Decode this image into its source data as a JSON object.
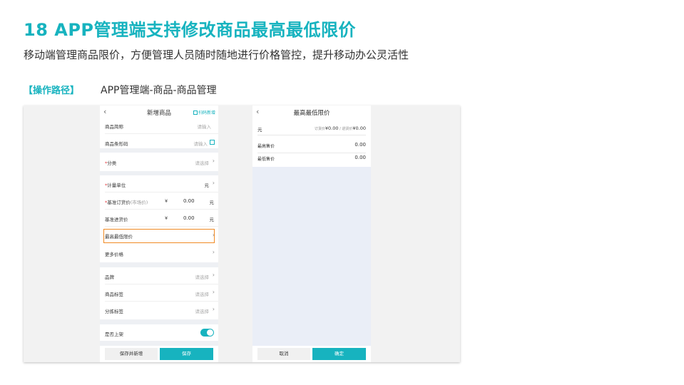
{
  "slide": {
    "title": "18  APP管理端支持修改商品最高最低限价",
    "subtitle": "移动端管理商品限价，方便管理人员随时随地进行价格管控，提升移动办公灵活性",
    "path_label": "【操作路径】",
    "path_value": "APP管理端-商品-商品管理"
  },
  "phone1": {
    "back": "‹",
    "title": "新增商品",
    "scan_label": "扫码新增",
    "rows": {
      "name": {
        "label": "商品简称",
        "placeholder": "请输入"
      },
      "barcode": {
        "label": "商品条形码",
        "placeholder": "请输入"
      },
      "category": {
        "req": "*",
        "label": "分类",
        "placeholder": "请选择"
      },
      "unit": {
        "req": "*",
        "label": "计量单位",
        "value": "元"
      },
      "order_price": {
        "req": "*",
        "label": "基准订货价",
        "hint": "(市场价)",
        "yen": "¥",
        "value": "0.00",
        "unit": "元"
      },
      "purchase_price": {
        "label": "基准进货价",
        "yen": "¥",
        "value": "0.00",
        "unit": "元"
      },
      "price_limit": {
        "label": "最高最低限价"
      },
      "more_price": {
        "label": "更多价格"
      },
      "brand": {
        "label": "品牌",
        "placeholder": "请选择"
      },
      "tag": {
        "label": "商品标签",
        "placeholder": "请选择"
      },
      "sort_tag": {
        "label": "分拣标签",
        "placeholder": "请选择"
      },
      "on_shelf": {
        "label": "是否上架",
        "checked": true
      }
    },
    "footer": {
      "save_new": "保存并新增",
      "save": "保存"
    }
  },
  "phone2": {
    "back": "‹",
    "title": "最高最低限价",
    "unit": "元",
    "ref_order_label": "订货价",
    "ref_order_value": "¥0.00",
    "ref_sep": " / ",
    "ref_purchase_label": "进货价",
    "ref_purchase_value": "¥0.00",
    "max_label": "最高售价",
    "max_value": "0.00",
    "min_label": "最低售价",
    "min_value": "0.00",
    "footer": {
      "cancel": "取消",
      "confirm": "确定"
    }
  },
  "colors": {
    "accent": "#17b3bf",
    "highlight": "#f08a24",
    "required": "#e4393c"
  },
  "chevron": "›"
}
